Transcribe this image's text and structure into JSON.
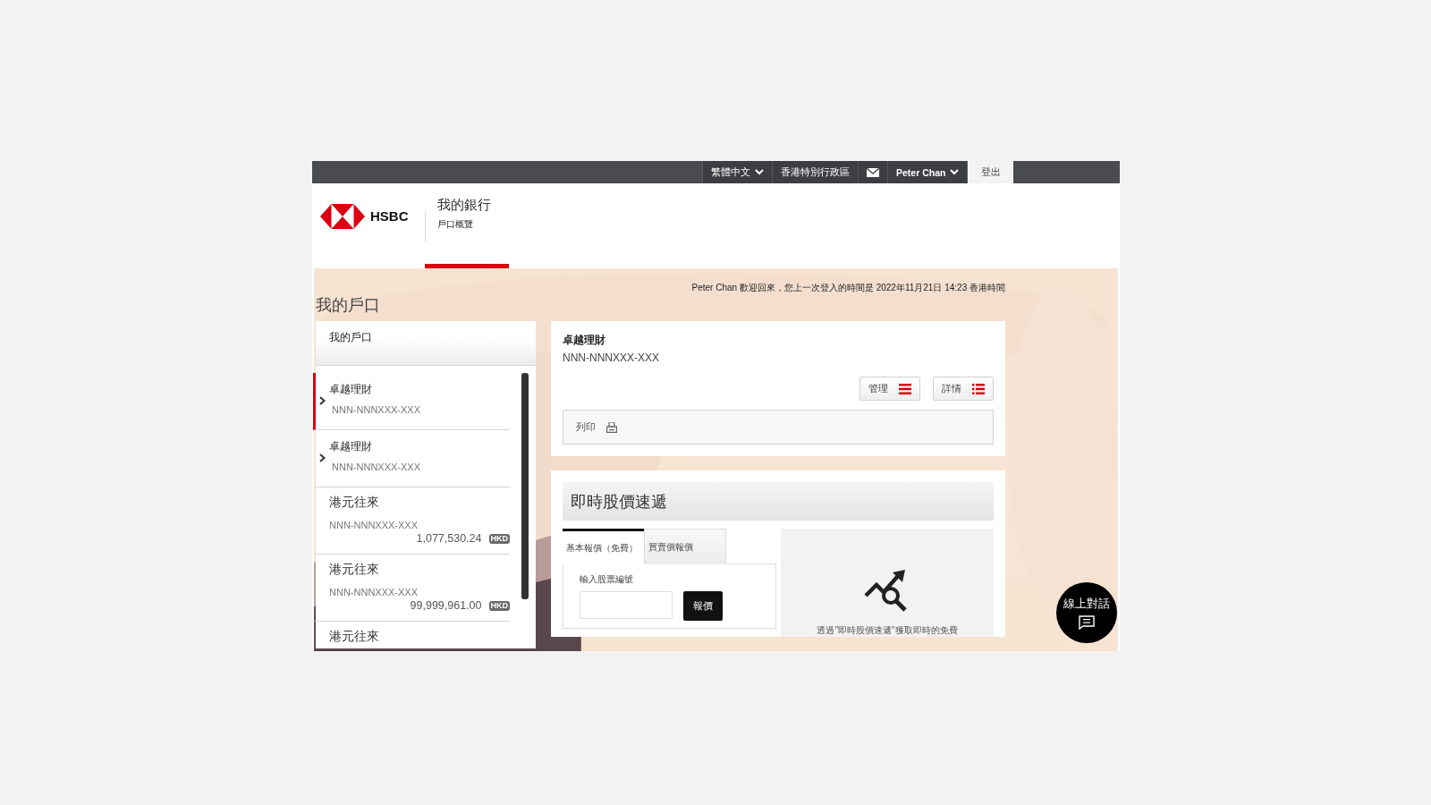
{
  "top_bar": {
    "language": "繁體中文",
    "region": "香港特別行政區",
    "user": "Peter Chan",
    "logout": "登出"
  },
  "header": {
    "logo_text": "HSBC",
    "section": "我的銀行",
    "subsection": "戶口概覽"
  },
  "welcome": "Peter Chan 歡迎回來，您上一次登入的時間是 2022年11月21日 14:23 香港時間",
  "page_title": "我的戶口",
  "accounts_panel": {
    "title": "我的戶口",
    "accounts": [
      {
        "kind": "group",
        "name": "卓越理財",
        "number": "NNN-NNNXXX-XXX",
        "selected": true
      },
      {
        "kind": "group",
        "name": "卓越理財",
        "number": "NNN-NNNXXX-XXX",
        "selected": false
      },
      {
        "kind": "account",
        "name": "港元往來",
        "number": "NNN-NNNXXX-XXX",
        "balance": "1,077,530.24",
        "currency": "HKD",
        "selected": false
      },
      {
        "kind": "account",
        "name": "港元往來",
        "number": "NNN-NNNXXX-XXX",
        "balance": "99,999,961.00",
        "currency": "HKD",
        "selected": false
      },
      {
        "kind": "account",
        "name": "港元往來",
        "selected": false
      }
    ]
  },
  "account_card": {
    "name": "卓越理財",
    "number": "NNN-NNNXXX-XXX",
    "buttons": [
      {
        "label": "管理",
        "kind": "menu"
      },
      {
        "label": "詳情",
        "kind": "list"
      }
    ],
    "print": "列印"
  },
  "stock_quote": {
    "title": "即時股價速遞",
    "tabs": [
      {
        "label": "基本報價（免費）",
        "selected": true
      },
      {
        "label": "買賣價報價",
        "selected": false
      }
    ],
    "input_label": "輸入股票編號",
    "quote_button": "報價",
    "info": "透過\"即時股價速遞\"獲取即時的免費"
  },
  "chat": {
    "label": "線上對話"
  }
}
